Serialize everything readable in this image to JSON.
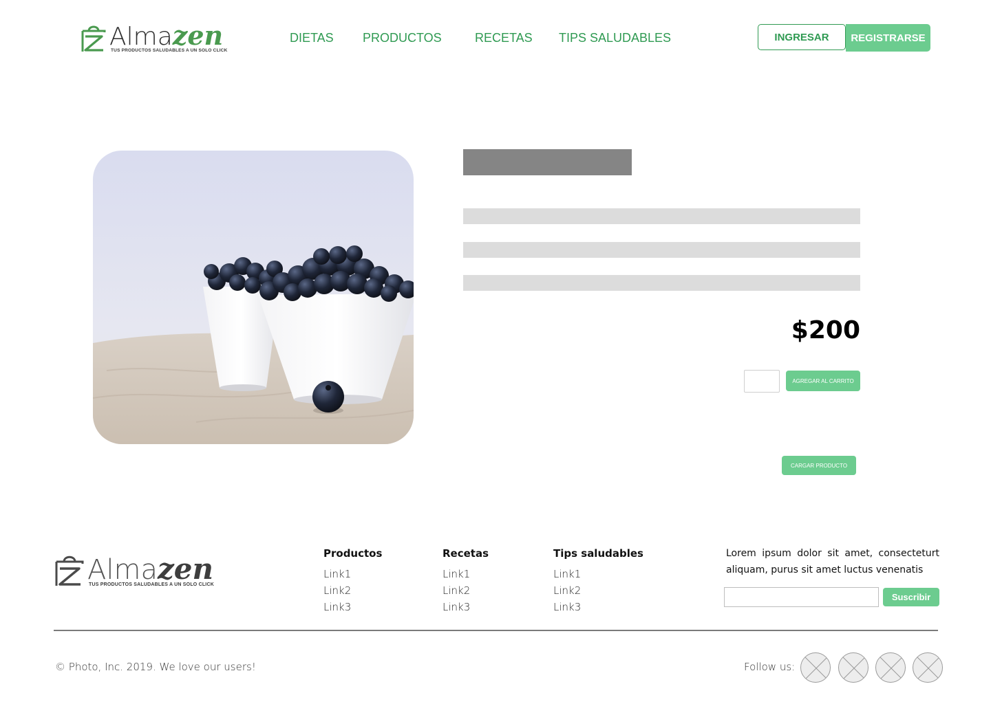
{
  "brand": {
    "name_part1": "Alma",
    "name_part2": "zen",
    "tagline": "TUS PRODUCTOS SALUDABLES A UN SOLO CLICK",
    "accent_color": "#2f9a52",
    "button_color": "#6ccc8f"
  },
  "nav": {
    "items": [
      {
        "label": "DIETAS"
      },
      {
        "label": "PRODUCTOS"
      },
      {
        "label": "RECETAS"
      },
      {
        "label": "TIPS SALUDABLES"
      }
    ],
    "login_label": "INGRESAR",
    "register_label": "REGISTRARSE"
  },
  "product": {
    "image_icon": "blueberries-bowls-photo",
    "price": "$200",
    "add_to_cart_label": "AGREGAR AL CARRITO",
    "upload_label": "CARGAR  PRODUCTO"
  },
  "footer": {
    "columns": [
      {
        "title": "Productos",
        "links": [
          "Link1",
          "Link2",
          "Link3"
        ]
      },
      {
        "title": "Recetas",
        "links": [
          "Link1",
          "Link2",
          "Link3"
        ]
      },
      {
        "title": "Tips saludables",
        "links": [
          "Link1",
          "Link2",
          "Link3"
        ]
      }
    ],
    "newsletter_text": "Lorem ipsum dolor sit amet, consecteturt aliquam, purus sit amet luctus venenatis",
    "subscribe_label": "Suscribir",
    "copyright": "© Photo, Inc. 2019. We love our users!",
    "follow_label": "Follow us:",
    "social_icons": [
      "social-placeholder-icon",
      "social-placeholder-icon",
      "social-placeholder-icon",
      "social-placeholder-icon"
    ]
  }
}
